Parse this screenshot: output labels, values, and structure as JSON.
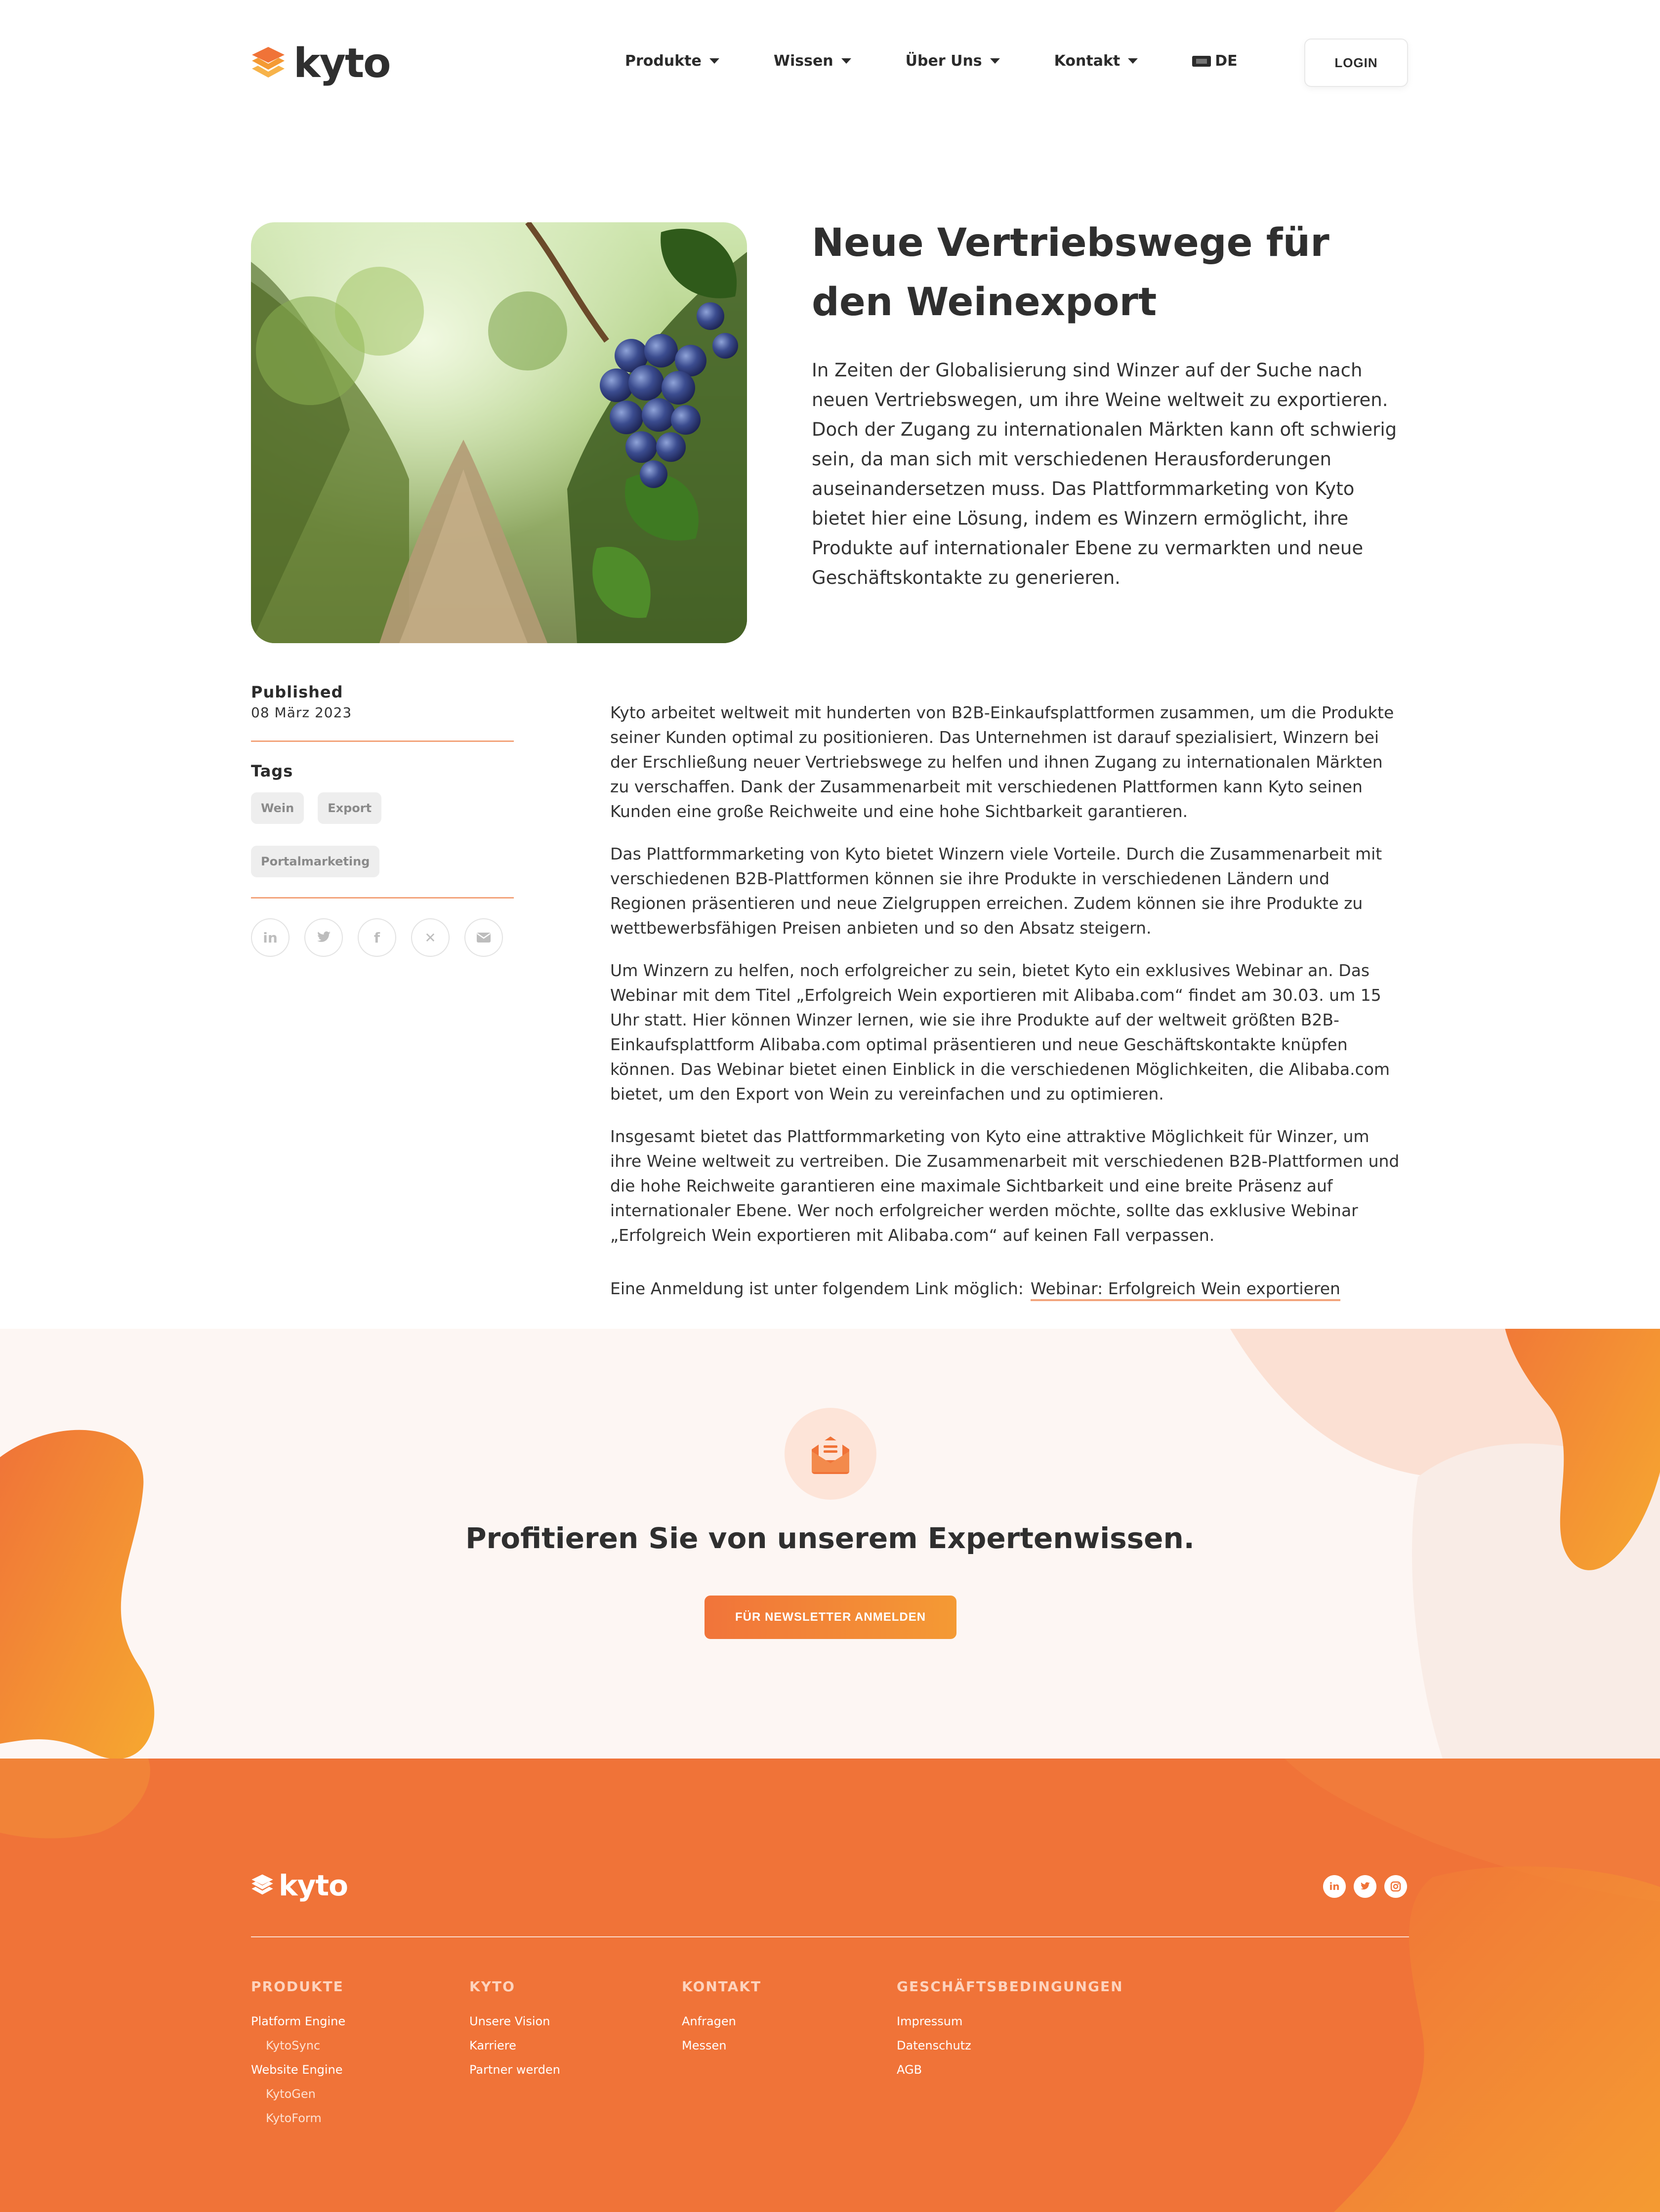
{
  "header": {
    "logo_text": "kyto",
    "nav": [
      {
        "label": "Produkte"
      },
      {
        "label": "Wissen"
      },
      {
        "label": "Über Uns"
      },
      {
        "label": "Kontakt"
      }
    ],
    "language": "DE",
    "login_label": "LOGIN"
  },
  "article": {
    "title": "Neue Vertriebswege für den Weinexport",
    "intro": "In Zeiten der Globalisierung sind Winzer auf der Suche nach neuen Vertriebswegen, um ihre Weine weltweit zu exportieren. Doch der Zugang zu internationalen Märkten kann oft schwierig sein, da man sich mit verschiedenen Herausforderungen auseinandersetzen muss. Das Plattformmarketing von Kyto bietet hier eine Lösung, indem es Winzern ermöglicht, ihre Produkte auf internationaler Ebene zu vermarkten und neue Geschäftskontakte zu generieren.",
    "published_label": "Published",
    "published_date": "08 März 2023",
    "tags_label": "Tags",
    "tags": [
      "Wein",
      "Export",
      "Portalmarketing"
    ],
    "share_icons": [
      "linkedin-icon",
      "twitter-icon",
      "facebook-icon",
      "xing-icon",
      "mail-icon"
    ],
    "paragraphs": [
      "Kyto arbeitet weltweit mit hunderten von B2B-Einkaufsplattformen zusammen, um die Produkte seiner Kunden optimal zu positionieren. Das Unternehmen ist darauf spezialisiert, Winzern bei der Erschließung neuer Vertriebswege zu helfen und ihnen Zugang zu internationalen Märkten zu verschaffen. Dank der Zusammenarbeit mit verschiedenen Plattformen kann Kyto seinen Kunden eine große Reichweite und eine hohe Sichtbarkeit garantieren.",
      "Das Plattformmarketing von Kyto bietet Winzern viele Vorteile. Durch die Zusammenarbeit mit verschiedenen B2B-Plattformen können sie ihre Produkte in verschiedenen Ländern und Regionen präsentieren und neue Zielgruppen erreichen. Zudem können sie ihre Produkte zu wettbewerbsfähigen Preisen anbieten und so den Absatz steigern.",
      "Um Winzern zu helfen, noch erfolgreicher zu sein, bietet Kyto ein exklusives Webinar an. Das Webinar mit dem Titel „Erfolgreich Wein exportieren mit Alibaba.com“ findet am 30.03. um 15 Uhr statt. Hier können Winzer lernen, wie sie ihre Produkte auf der weltweit größten B2B-Einkaufsplattform Alibaba.com optimal präsentieren und neue Geschäftskontakte knüpfen können. Das Webinar bietet einen Einblick in die verschiedenen Möglichkeiten, die Alibaba.com bietet, um den Export von Wein zu vereinfachen und zu optimieren.",
      "Insgesamt bietet das Plattformmarketing von Kyto eine attraktive Möglichkeit für Winzer, um ihre Weine weltweit zu vertreiben. Die Zusammenarbeit mit verschiedenen B2B-Plattformen und die hohe Reichweite garantieren eine maximale Sichtbarkeit und eine breite Präsenz auf internationaler Ebene. Wer noch erfolgreicher werden möchte, sollte das exklusive Webinar „Erfolgreich Wein exportieren mit Alibaba.com“ auf keinen Fall verpassen."
    ],
    "registration_text": "Eine Anmeldung ist unter folgendem Link möglich:",
    "registration_link": "Webinar: Erfolgreich Wein exportieren"
  },
  "newsletter": {
    "title": "Profitieren Sie von unserem Expertenwissen.",
    "button": "FÜR NEWSLETTER ANMELDEN"
  },
  "footer": {
    "logo_text": "kyto",
    "social_icons": [
      "linkedin-icon",
      "twitter-icon",
      "instagram-icon"
    ],
    "columns": [
      {
        "title": "PRODUKTE",
        "links": [
          "Platform Engine",
          "KytoSync",
          "Website Engine",
          "KytoGen",
          "KytoForm"
        ]
      },
      {
        "title": "KYTO",
        "links": [
          "Unsere Vision",
          "Karriere",
          "Partner werden"
        ]
      },
      {
        "title": "KONTAKT",
        "links": [
          "Anfragen",
          "Messen"
        ]
      },
      {
        "title": "GESCHÄFTSBEDINGUNGEN",
        "links": [
          "Impressum",
          "Datenschutz",
          "AGB"
        ]
      }
    ]
  },
  "colors": {
    "brand_orange": "#f07338",
    "brand_orange_light": "#f49a34",
    "accent_line": "#f3a47c",
    "newsletter_bg": "#fdf6f3"
  }
}
